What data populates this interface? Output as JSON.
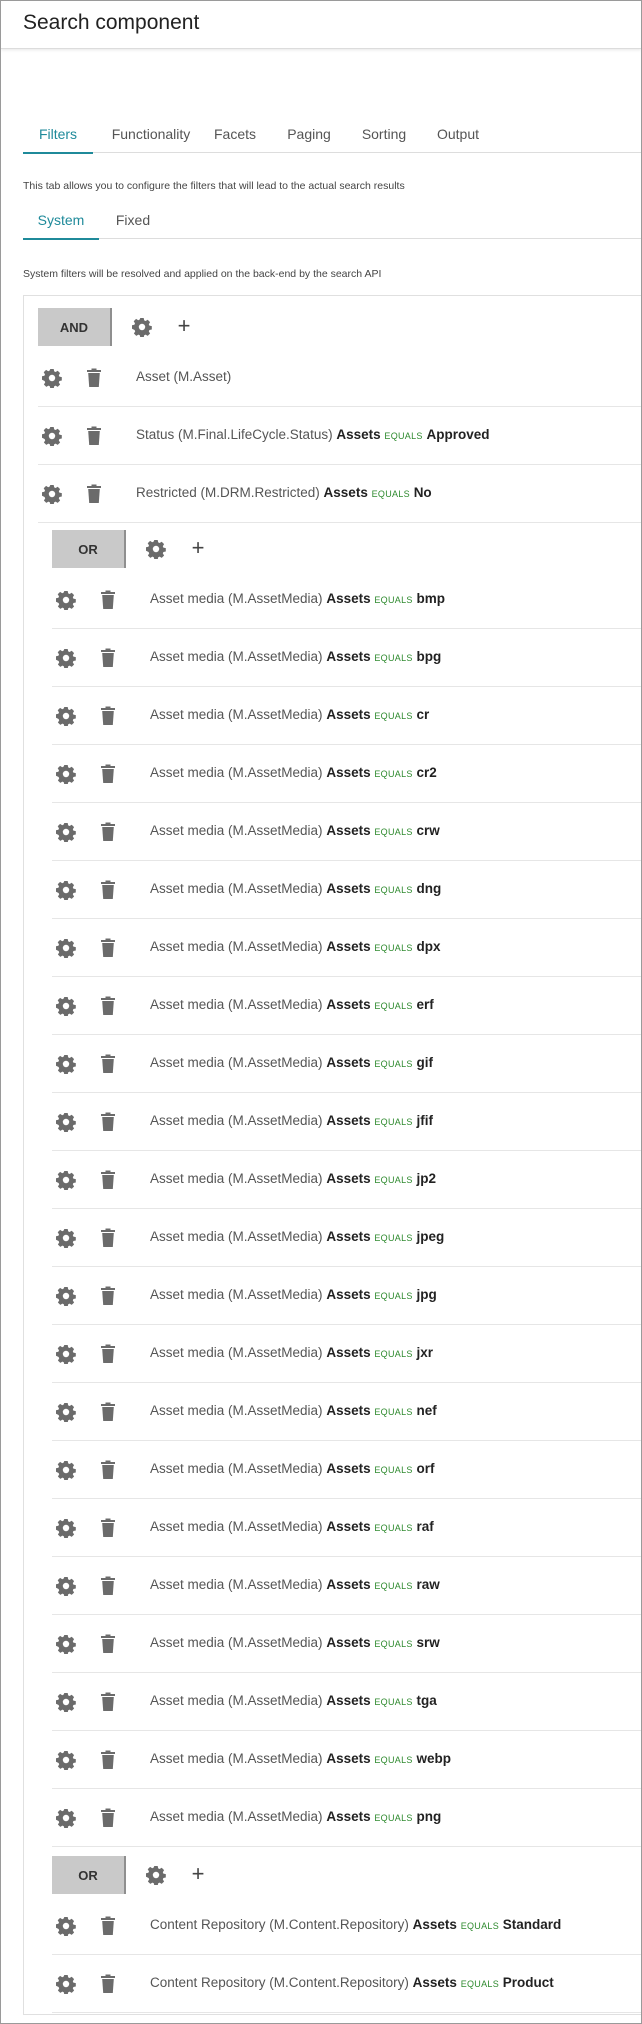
{
  "header": {
    "title": "Search component"
  },
  "tabs": [
    {
      "label": "Filters",
      "active": true
    },
    {
      "label": "Functionality",
      "active": false
    },
    {
      "label": "Facets",
      "active": false
    },
    {
      "label": "Paging",
      "active": false
    },
    {
      "label": "Sorting",
      "active": false
    },
    {
      "label": "Output",
      "active": false
    }
  ],
  "filters_help": "This tab allows you to configure the filters that will lead to the actual search results",
  "subtabs": [
    {
      "label": "System",
      "active": true
    },
    {
      "label": "Fixed",
      "active": false
    }
  ],
  "system_help": "System filters will be resolved and applied on the back-end by the search API",
  "colors": {
    "accent": "#1f8a9a",
    "operator": "#2e8a2e",
    "op_button": "#c9c9c9"
  },
  "icons": {
    "settings": "gear-icon",
    "delete": "trash-icon",
    "add": "plus-icon"
  },
  "root_group": {
    "operator": "AND",
    "add_label": "+",
    "rows": [
      {
        "field": "Asset (M.Asset)",
        "entity": "",
        "op": "",
        "value": ""
      },
      {
        "field": "Status (M.Final.LifeCycle.Status)",
        "entity": "Assets",
        "op": "EQUALS",
        "value": "Approved"
      },
      {
        "field": "Restricted (M.DRM.Restricted)",
        "entity": "Assets",
        "op": "EQUALS",
        "value": "No"
      }
    ]
  },
  "or_group_1": {
    "operator": "OR",
    "add_label": "+",
    "rows": [
      {
        "field": "Asset media (M.AssetMedia)",
        "entity": "Assets",
        "op": "EQUALS",
        "value": "bmp"
      },
      {
        "field": "Asset media (M.AssetMedia)",
        "entity": "Assets",
        "op": "EQUALS",
        "value": "bpg"
      },
      {
        "field": "Asset media (M.AssetMedia)",
        "entity": "Assets",
        "op": "EQUALS",
        "value": "cr"
      },
      {
        "field": "Asset media (M.AssetMedia)",
        "entity": "Assets",
        "op": "EQUALS",
        "value": "cr2"
      },
      {
        "field": "Asset media (M.AssetMedia)",
        "entity": "Assets",
        "op": "EQUALS",
        "value": "crw"
      },
      {
        "field": "Asset media (M.AssetMedia)",
        "entity": "Assets",
        "op": "EQUALS",
        "value": "dng"
      },
      {
        "field": "Asset media (M.AssetMedia)",
        "entity": "Assets",
        "op": "EQUALS",
        "value": "dpx"
      },
      {
        "field": "Asset media (M.AssetMedia)",
        "entity": "Assets",
        "op": "EQUALS",
        "value": "erf"
      },
      {
        "field": "Asset media (M.AssetMedia)",
        "entity": "Assets",
        "op": "EQUALS",
        "value": "gif"
      },
      {
        "field": "Asset media (M.AssetMedia)",
        "entity": "Assets",
        "op": "EQUALS",
        "value": "jfif"
      },
      {
        "field": "Asset media (M.AssetMedia)",
        "entity": "Assets",
        "op": "EQUALS",
        "value": "jp2"
      },
      {
        "field": "Asset media (M.AssetMedia)",
        "entity": "Assets",
        "op": "EQUALS",
        "value": "jpeg"
      },
      {
        "field": "Asset media (M.AssetMedia)",
        "entity": "Assets",
        "op": "EQUALS",
        "value": "jpg"
      },
      {
        "field": "Asset media (M.AssetMedia)",
        "entity": "Assets",
        "op": "EQUALS",
        "value": "jxr"
      },
      {
        "field": "Asset media (M.AssetMedia)",
        "entity": "Assets",
        "op": "EQUALS",
        "value": "nef"
      },
      {
        "field": "Asset media (M.AssetMedia)",
        "entity": "Assets",
        "op": "EQUALS",
        "value": "orf"
      },
      {
        "field": "Asset media (M.AssetMedia)",
        "entity": "Assets",
        "op": "EQUALS",
        "value": "raf"
      },
      {
        "field": "Asset media (M.AssetMedia)",
        "entity": "Assets",
        "op": "EQUALS",
        "value": "raw"
      },
      {
        "field": "Asset media (M.AssetMedia)",
        "entity": "Assets",
        "op": "EQUALS",
        "value": "srw"
      },
      {
        "field": "Asset media (M.AssetMedia)",
        "entity": "Assets",
        "op": "EQUALS",
        "value": "tga"
      },
      {
        "field": "Asset media (M.AssetMedia)",
        "entity": "Assets",
        "op": "EQUALS",
        "value": "webp"
      },
      {
        "field": "Asset media (M.AssetMedia)",
        "entity": "Assets",
        "op": "EQUALS",
        "value": "png"
      }
    ]
  },
  "or_group_2": {
    "operator": "OR",
    "add_label": "+",
    "rows": [
      {
        "field": "Content Repository (M.Content.Repository)",
        "entity": "Assets",
        "op": "EQUALS",
        "value": "Standard"
      },
      {
        "field": "Content Repository (M.Content.Repository)",
        "entity": "Assets",
        "op": "EQUALS",
        "value": "Product"
      }
    ]
  }
}
